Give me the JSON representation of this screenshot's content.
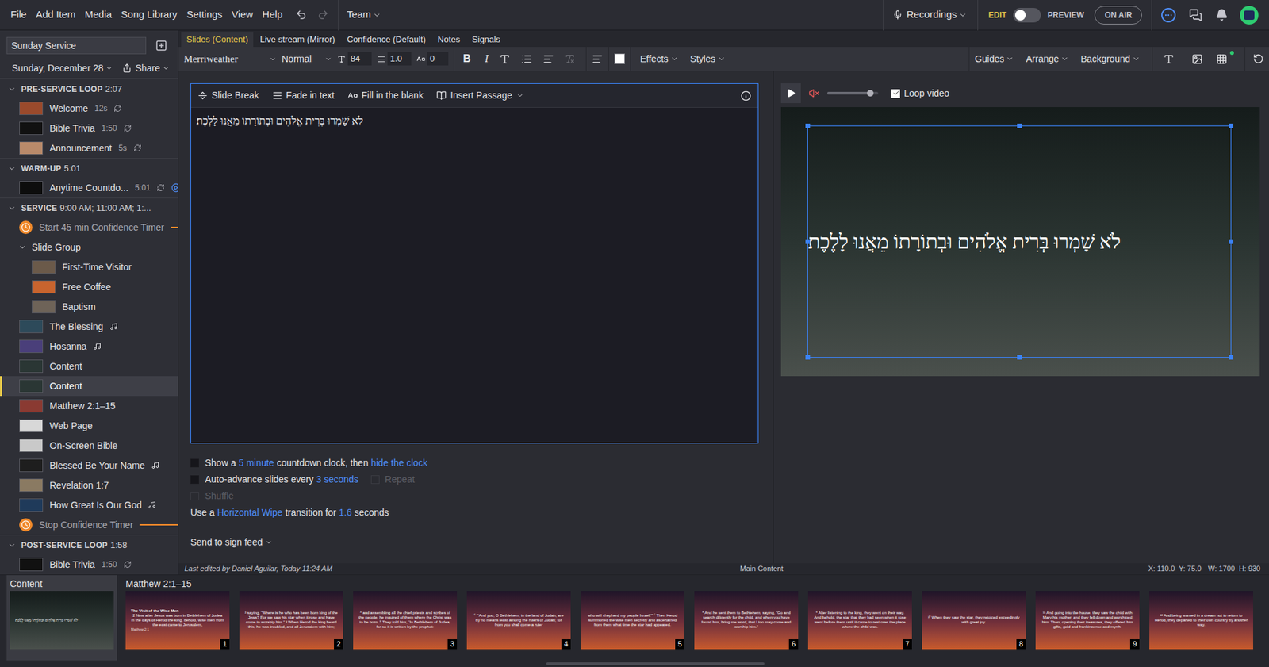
{
  "menu": [
    "File",
    "Add Item",
    "Media",
    "Song Library",
    "Settings",
    "View",
    "Help"
  ],
  "team": "Team",
  "recordings": "Recordings",
  "mode": {
    "edit": "EDIT",
    "preview": "PREVIEW",
    "preview_on": false
  },
  "on_air": "ON AIR",
  "sidebar": {
    "title": "Sunday Service",
    "date": "Sunday, December 28",
    "share": "Share",
    "sections": [
      {
        "name": "PRE-SERVICE LOOP",
        "time": "2:07",
        "expanded": true,
        "items": [
          {
            "kind": "media",
            "label": "Welcome",
            "duration": "12s",
            "loop": true,
            "song": false,
            "live": false,
            "color": "#9a4a2c",
            "selected": false
          },
          {
            "kind": "media",
            "label": "Bible Trivia",
            "duration": "1:50",
            "loop": true,
            "song": false,
            "live": false,
            "color": "#111111",
            "selected": false
          },
          {
            "kind": "media",
            "label": "Announcement",
            "duration": "5s",
            "loop": true,
            "song": false,
            "live": false,
            "color": "#b98a6a",
            "selected": false
          }
        ]
      },
      {
        "name": "WARM-UP",
        "time": "5:01",
        "expanded": true,
        "items": [
          {
            "kind": "media",
            "label": "Anytime Countdo...",
            "duration": "5:01",
            "loop": true,
            "song": false,
            "live": true,
            "color": "#0d0d0d",
            "selected": false
          }
        ]
      },
      {
        "name": "SERVICE",
        "time": "9:00 AM; 11:00 AM; 1:...",
        "expanded": true,
        "items": [
          {
            "kind": "timer",
            "label": "Start 45 min Confidence Timer",
            "color": "#f0892a"
          },
          {
            "kind": "group",
            "label": "Slide Group",
            "expanded": true,
            "children": [
              {
                "kind": "media",
                "label": "First-Time Visitor",
                "duration": "",
                "loop": false,
                "song": false,
                "live": false,
                "color": "#6b5a4a",
                "selected": false
              },
              {
                "kind": "media",
                "label": "Free Coffee",
                "duration": "",
                "loop": false,
                "song": false,
                "live": false,
                "color": "#c8642e",
                "selected": false
              },
              {
                "kind": "media",
                "label": "Baptism",
                "duration": "",
                "loop": false,
                "song": false,
                "live": false,
                "color": "#6e6358",
                "selected": false
              }
            ]
          },
          {
            "kind": "media",
            "label": "The Blessing",
            "duration": "",
            "loop": false,
            "song": true,
            "live": false,
            "color": "#2d4a5a",
            "selected": false
          },
          {
            "kind": "media",
            "label": "Hosanna",
            "duration": "",
            "loop": false,
            "song": true,
            "live": false,
            "color": "#4a3f7a",
            "selected": false
          },
          {
            "kind": "media",
            "label": "Content",
            "duration": "",
            "loop": false,
            "song": false,
            "live": false,
            "color": "#2a3634",
            "selected": false
          },
          {
            "kind": "media",
            "label": "Content",
            "duration": "",
            "loop": false,
            "song": false,
            "live": false,
            "color": "#2a3634",
            "selected": true
          },
          {
            "kind": "media",
            "label": "Matthew 2:1–15",
            "duration": "",
            "loop": false,
            "song": false,
            "live": false,
            "color": "#8a3a32",
            "selected": false
          },
          {
            "kind": "media",
            "label": "Web Page",
            "duration": "",
            "loop": false,
            "song": false,
            "live": false,
            "color": "#d8d8d8",
            "selected": false
          },
          {
            "kind": "media",
            "label": "On-Screen Bible",
            "duration": "",
            "loop": false,
            "song": false,
            "live": false,
            "color": "#c9c9c9",
            "selected": false
          },
          {
            "kind": "media",
            "label": "Blessed Be Your Name",
            "duration": "",
            "loop": false,
            "song": true,
            "live": false,
            "color": "#1e1e1e",
            "selected": false
          },
          {
            "kind": "media",
            "label": "Revelation 1:7",
            "duration": "",
            "loop": false,
            "song": false,
            "live": false,
            "color": "#8a7a62",
            "selected": false
          },
          {
            "kind": "media",
            "label": "How Great Is Our God",
            "duration": "",
            "loop": false,
            "song": true,
            "live": false,
            "color": "#1f3a5a",
            "selected": false
          },
          {
            "kind": "timer",
            "label": "Stop Confidence Timer",
            "color": "#f0892a"
          }
        ]
      },
      {
        "name": "POST-SERVICE LOOP",
        "time": "1:58",
        "expanded": true,
        "items": [
          {
            "kind": "media",
            "label": "Bible Trivia",
            "duration": "1:50",
            "loop": true,
            "song": false,
            "live": false,
            "color": "#111111",
            "selected": false
          }
        ]
      }
    ]
  },
  "tabs": [
    {
      "label": "Slides (Content)",
      "selected": true
    },
    {
      "label": "Live stream (Mirror)",
      "selected": false
    },
    {
      "label": "Confidence (Default)",
      "selected": false
    },
    {
      "label": "Notes",
      "selected": false
    },
    {
      "label": "Signals",
      "selected": false
    }
  ],
  "toolbar": {
    "font": "Merriweather",
    "style": "Normal",
    "size": "84",
    "line_height": "1.0",
    "spacing": "0",
    "bold": "B",
    "italic": "I",
    "text_color": "#ffffff",
    "effects": "Effects",
    "styles": "Styles",
    "guides": "Guides",
    "arrange": "Arrange",
    "background": "Background"
  },
  "editor": {
    "tools": [
      {
        "label": "Slide Break",
        "dropdown": false
      },
      {
        "label": "Fade in text",
        "dropdown": false
      },
      {
        "label": "Fill in the blank",
        "dropdown": false
      },
      {
        "label": "Insert Passage",
        "dropdown": true
      }
    ],
    "text": "לֹא שָׁמְרוּ בְּרִית אֱלֹהִים וּבְתוֹרָתוֹ מֵאֲנוּ לָלֶכֶת׃"
  },
  "options": [
    {
      "kind": "checkbox",
      "checked": false,
      "disabled": false,
      "parts": [
        {
          "text": "Show a",
          "link": false
        },
        {
          "text": "5 minute",
          "link": true
        },
        {
          "text": "countdown clock, then",
          "link": false
        },
        {
          "text": "hide the clock",
          "link": true
        }
      ]
    },
    {
      "kind": "checkbox",
      "checked": false,
      "disabled": false,
      "parts": [
        {
          "text": "Auto-advance slides every",
          "link": false
        },
        {
          "text": "3 seconds",
          "link": true
        }
      ],
      "extra": {
        "text": "Repeat",
        "checked": false,
        "disabled": true
      }
    },
    {
      "kind": "checkbox",
      "checked": false,
      "disabled": true,
      "parts": [
        {
          "text": "Shuffle",
          "link": false
        }
      ]
    },
    {
      "kind": "text",
      "checked": false,
      "disabled": false,
      "parts": [
        {
          "text": "Use a",
          "link": false
        },
        {
          "text": "Horizontal Wipe",
          "link": true
        },
        {
          "text": "transition for",
          "link": false
        },
        {
          "text": "1.6",
          "link": true
        },
        {
          "text": "seconds",
          "link": false
        }
      ]
    }
  ],
  "sign_feed": "Send to sign feed",
  "preview": {
    "playing": false,
    "muted": true,
    "volume": 0.85,
    "loop_label": "Loop video",
    "loop": true,
    "text": "לֹא שָׁמְרוּ בְּרִית אֱלֹהִים וּבְתוֹרָתוֹ מֵאֲנוּ לָלֶכֶת׃"
  },
  "status": {
    "edited": "Last edited by Daniel Aguilar, Today 11:24 AM",
    "layer": "Main Content",
    "position": "X: 110.0  Y: 75.0",
    "size": "W: 1700  H: 930"
  },
  "filmstrip": [
    {
      "name": "Content",
      "selected": true,
      "slides": [
        {
          "kind": "image",
          "title": "",
          "text": "לֹא שָׁמְרוּ בְּרִית אֱלֹהִים וּבְתוֹרָתוֹ מֵאֲנוּ לָלֶכֶת׃",
          "reference": "",
          "number": ""
        }
      ]
    },
    {
      "name": "Matthew 2:1–15",
      "selected": false,
      "slides": [
        {
          "kind": "scripture",
          "title": "The Visit of the Wise Men",
          "text": "2 Now after Jesus was born in Bethlehem of Judea in the days of Herod the king, behold, wise men from the east came to Jerusalem,",
          "reference": "Matthew 2:1",
          "number": "1"
        },
        {
          "kind": "scripture",
          "title": "",
          "text": "² saying, “Where is he who has been born king of the Jews? For we saw his star when it rose and have come to worship him.” ³ When Herod the king heard this, he was troubled, and all Jerusalem with him;",
          "reference": "",
          "number": "2"
        },
        {
          "kind": "scripture",
          "title": "",
          "text": "⁴ and assembling all the chief priests and scribes of the people, he inquired of them where the Christ was to be born. ⁵ They told him, “In Bethlehem of Judea, for so it is written by the prophet:",
          "reference": "",
          "number": "3"
        },
        {
          "kind": "scripture",
          "title": "",
          "text": "⁶ “‘And you, O Bethlehem, in the land of Judah, are by no means least among the rulers of Judah; for from you shall come a ruler",
          "reference": "",
          "number": "4"
        },
        {
          "kind": "scripture",
          "title": "",
          "text": "who will shepherd my people Israel.’” ⁷ Then Herod summoned the wise men secretly and ascertained from them what time the star had appeared.",
          "reference": "",
          "number": "5"
        },
        {
          "kind": "scripture",
          "title": "",
          "text": "⁸ And he sent them to Bethlehem, saying, “Go and search diligently for the child, and when you have found him, bring me word, that I too may come and worship him.”",
          "reference": "",
          "number": "6"
        },
        {
          "kind": "scripture",
          "title": "",
          "text": "⁹ After listening to the king, they went on their way. And behold, the star that they had seen when it rose went before them until it came to rest over the place where the child was.",
          "reference": "",
          "number": "7"
        },
        {
          "kind": "scripture",
          "title": "",
          "text": "¹⁰ When they saw the star, they rejoiced exceedingly with great joy.",
          "reference": "",
          "number": "8"
        },
        {
          "kind": "scripture",
          "title": "",
          "text": "¹¹ And going into the house, they saw the child with Mary his mother, and they fell down and worshiped him. Then, opening their treasures, they offered him gifts, gold and frankincense and myrrh.",
          "reference": "",
          "number": "9"
        },
        {
          "kind": "scripture",
          "title": "",
          "text": "¹² And being warned in a dream not to return to Herod, they departed to their own country by another way.",
          "reference": "",
          "number": ""
        }
      ]
    }
  ]
}
